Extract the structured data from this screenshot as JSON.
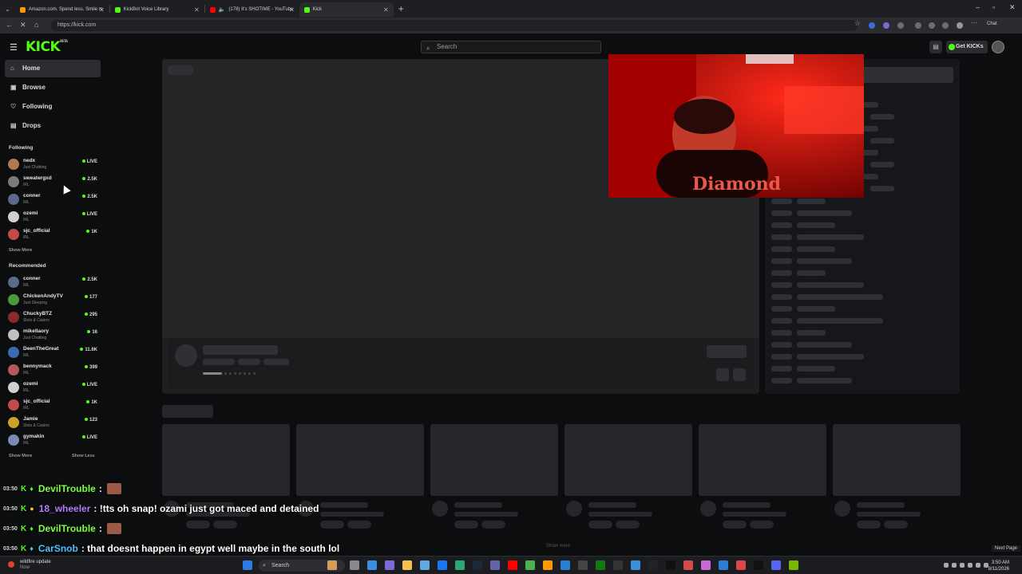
{
  "browser": {
    "tabs": [
      {
        "label": "Amazon.com. Spend less. Smile m",
        "favicon_color": "#ff9900"
      },
      {
        "label": "KickBot Voice Library",
        "favicon_color": "#53fc18"
      },
      {
        "label": "(178) It's SHOTIME - YouTube",
        "favicon_color": "#ff0000"
      },
      {
        "label": "Kick",
        "favicon_color": "#53fc18"
      }
    ],
    "url": "https://kick.com"
  },
  "header": {
    "logo": "KICK",
    "logo_sup": "BETA",
    "search_placeholder": "Search",
    "get_kicks_label": "Get KICKs"
  },
  "sidebar": {
    "nav": [
      {
        "label": "Home",
        "icon": "home-icon",
        "glyph": "⌂"
      },
      {
        "label": "Browse",
        "icon": "browse-icon",
        "glyph": "▣"
      },
      {
        "label": "Following",
        "icon": "heart-icon",
        "glyph": "♡"
      },
      {
        "label": "Drops",
        "icon": "drops-icon",
        "glyph": "▤"
      }
    ],
    "following_title": "Following",
    "following": [
      {
        "name": "nedx",
        "category": "Just Chatting",
        "viewers": "LIVE",
        "color": "#b07a52"
      },
      {
        "name": "sweatergxd",
        "category": "IRL",
        "viewers": "2.5K",
        "color": "#7a7a7a"
      },
      {
        "name": "conner",
        "category": "IRL",
        "viewers": "2.5K",
        "color": "#5a6a8a"
      },
      {
        "name": "ozemi",
        "category": "IRL",
        "viewers": "LIVE",
        "color": "#d0d0d0"
      },
      {
        "name": "sjc_official",
        "category": "IRL",
        "viewers": "1K",
        "color": "#c24a4a"
      }
    ],
    "show_more_1": "Show More",
    "recommended_title": "Recommended",
    "recommended": [
      {
        "name": "conner",
        "category": "IRL",
        "viewers": "2.5K",
        "color": "#5a6a8a"
      },
      {
        "name": "ChickenAndyTV",
        "category": "Just Sleeping",
        "viewers": "177",
        "color": "#4a9a3a"
      },
      {
        "name": "ChuckyBTZ",
        "category": "Slots & Casino",
        "viewers": "295",
        "color": "#8a2a2a"
      },
      {
        "name": "mikellaory",
        "category": "Just Chatting",
        "viewers": "16",
        "color": "#c0c0c0"
      },
      {
        "name": "DeenTheGreat",
        "category": "IRL",
        "viewers": "11.6K",
        "color": "#3a6ab0"
      },
      {
        "name": "bennymack",
        "category": "IRL",
        "viewers": "399",
        "color": "#b05a5a"
      },
      {
        "name": "ozemi",
        "category": "IRL",
        "viewers": "LIVE",
        "color": "#d0d0d0"
      },
      {
        "name": "sjc_official",
        "category": "IRL",
        "viewers": "1K",
        "color": "#c24a4a"
      },
      {
        "name": "Jamie",
        "category": "Slots & Casino",
        "viewers": "123",
        "color": "#c9a227"
      },
      {
        "name": "gymakin",
        "category": "IRL",
        "viewers": "LIVE",
        "color": "#7a8ab0"
      }
    ],
    "show_more_2": "Show More",
    "show_less": "Show Less"
  },
  "main": {
    "show_more": "Show more",
    "next_page": "Next Page"
  },
  "chat": [
    {
      "time": "03:50",
      "user": "DevilTrouble",
      "user_color": "#7dff4a",
      "message": "",
      "emote": true
    },
    {
      "time": "03:50",
      "user": "18_wheeler",
      "user_color": "#b47cff",
      "message": ": !tts oh snap! ozami just got maced and detained",
      "emote": false
    },
    {
      "time": "03:50",
      "user": "DevilTrouble",
      "user_color": "#7dff4a",
      "message": "",
      "emote": true
    },
    {
      "time": "03:50",
      "user": "CarSnob",
      "user_color": "#4ec3ff",
      "message": ": that doesnt happen in egypt well maybe in the south lol",
      "emote": false
    }
  ],
  "taskbar": {
    "weather_title": "wildfire update",
    "weather_sub": "Now",
    "search_label": "Search",
    "time": "3:50 AM",
    "date": "8/11/2026"
  },
  "colors": {
    "accent": "#53fc18",
    "background": "#0c0d0e"
  }
}
